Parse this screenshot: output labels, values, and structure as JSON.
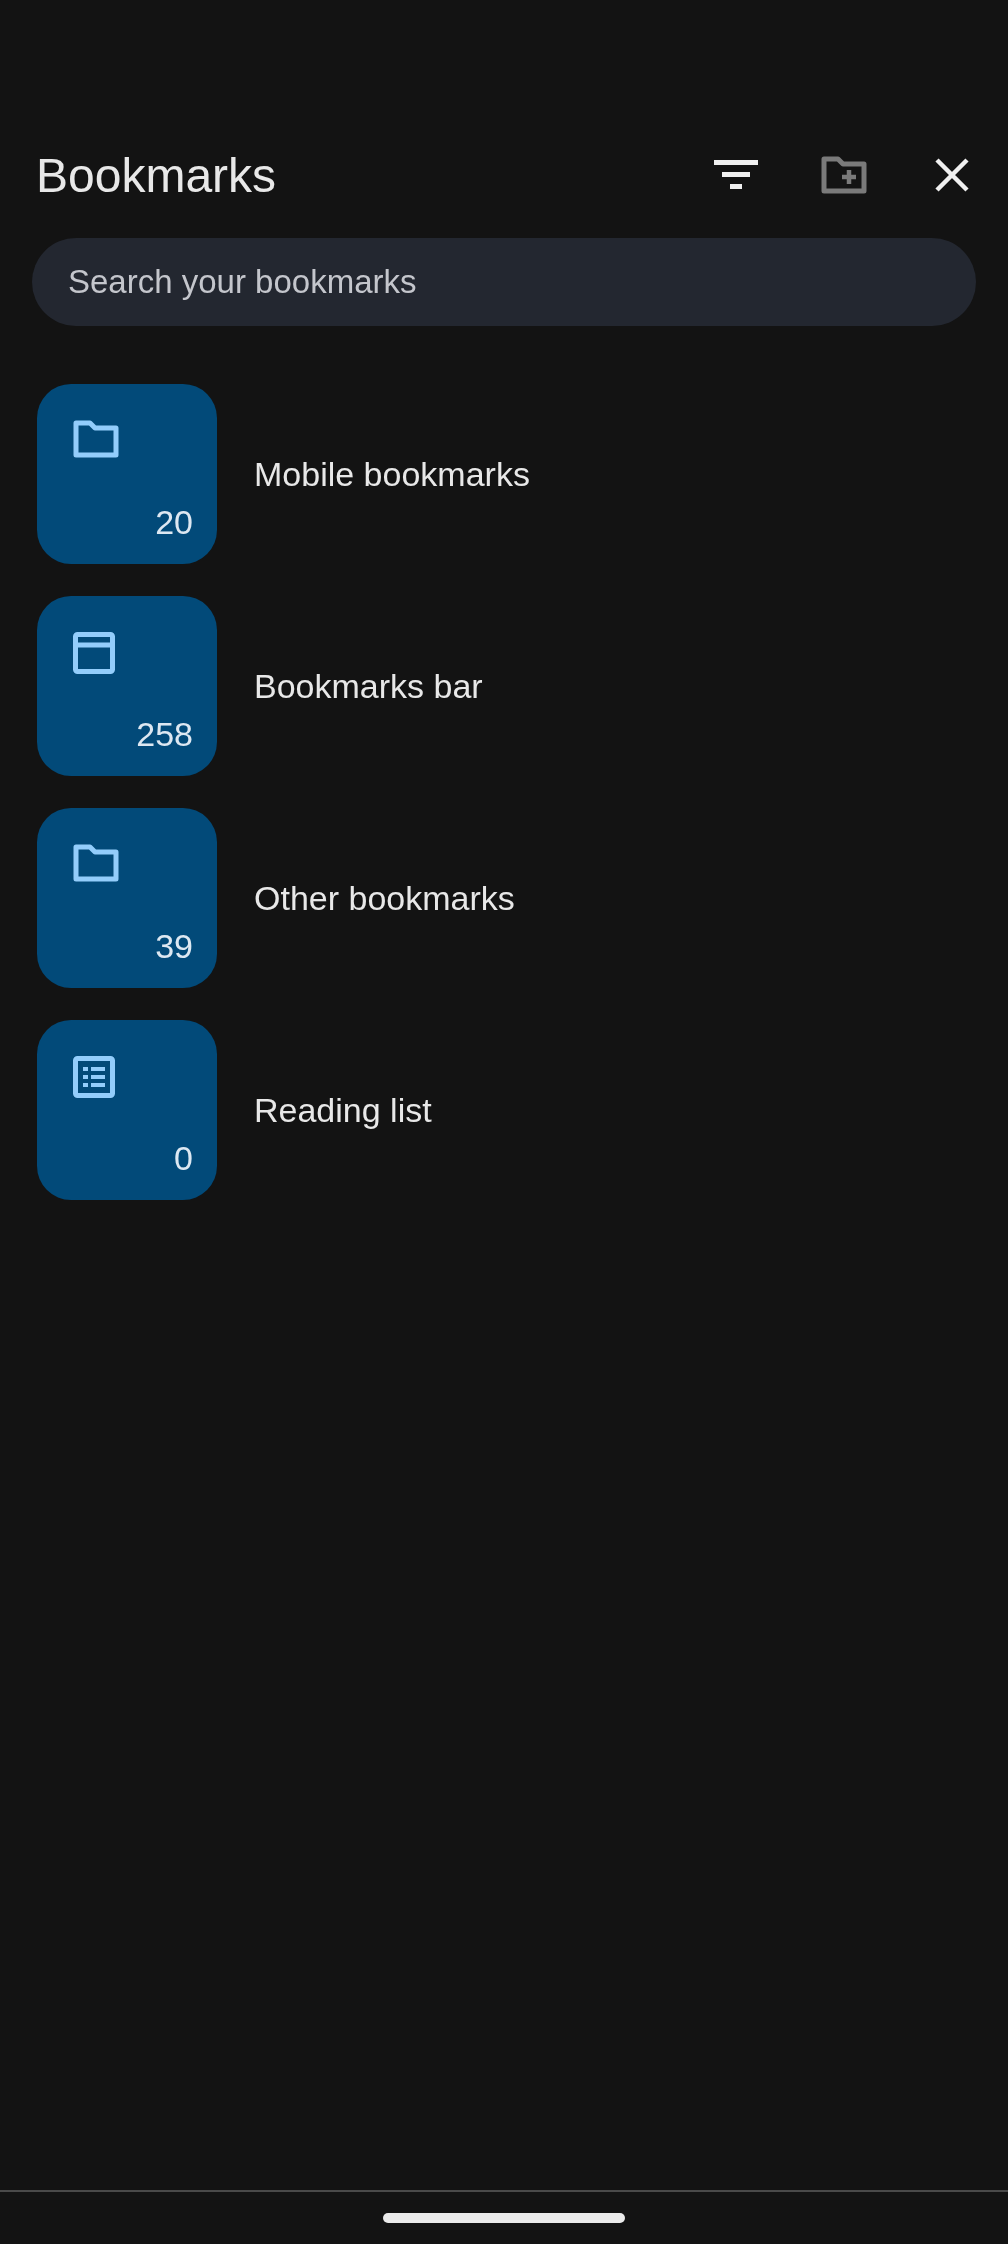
{
  "header": {
    "title": "Bookmarks",
    "actions": [
      {
        "kind": "sort",
        "disabled": false
      },
      {
        "kind": "new_folder",
        "disabled": true
      },
      {
        "kind": "close",
        "disabled": false
      }
    ]
  },
  "search": {
    "placeholder": "Search your bookmarks"
  },
  "folders": [
    {
      "kind": "folder",
      "name": "Mobile bookmarks",
      "count": "20"
    },
    {
      "kind": "bar",
      "name": "Bookmarks bar",
      "count": "258"
    },
    {
      "kind": "folder",
      "name": "Other bookmarks",
      "count": "39"
    },
    {
      "kind": "list",
      "name": "Reading list",
      "count": "0"
    }
  ]
}
